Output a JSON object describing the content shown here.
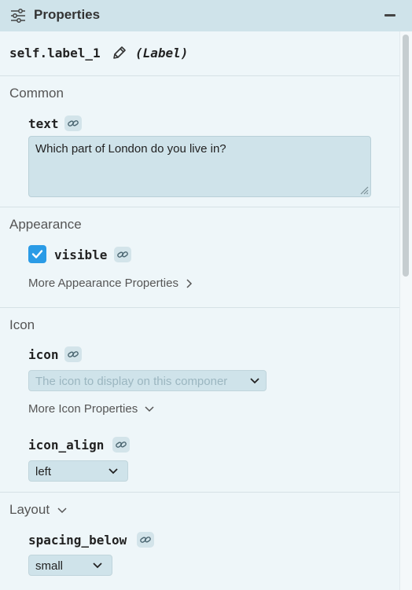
{
  "header": {
    "title": "Properties",
    "icon": "sliders-icon",
    "collapse_icon": "minus-icon"
  },
  "component": {
    "name": "self.label_1",
    "type": "(Label)",
    "edit_icon": "pencil-icon"
  },
  "sections": {
    "common": {
      "title": "Common",
      "text_prop": {
        "label": "text",
        "value": "Which part of London do you live in?"
      }
    },
    "appearance": {
      "title": "Appearance",
      "visible_prop": {
        "label": "visible",
        "checked": true
      },
      "more_label": "More Appearance Properties"
    },
    "icon": {
      "title": "Icon",
      "icon_prop": {
        "label": "icon",
        "placeholder": "The icon to display on this componer"
      },
      "more_label": "More Icon Properties",
      "icon_align_prop": {
        "label": "icon_align",
        "value": "left"
      }
    },
    "layout": {
      "title": "Layout",
      "spacing_below_prop": {
        "label": "spacing_below",
        "value": "small"
      }
    }
  },
  "colors": {
    "header_bg": "#cfe3ea",
    "panel_bg": "#eef6f9",
    "checkbox_accent": "#2a9be6",
    "badge_bg": "#d3e4ea"
  }
}
